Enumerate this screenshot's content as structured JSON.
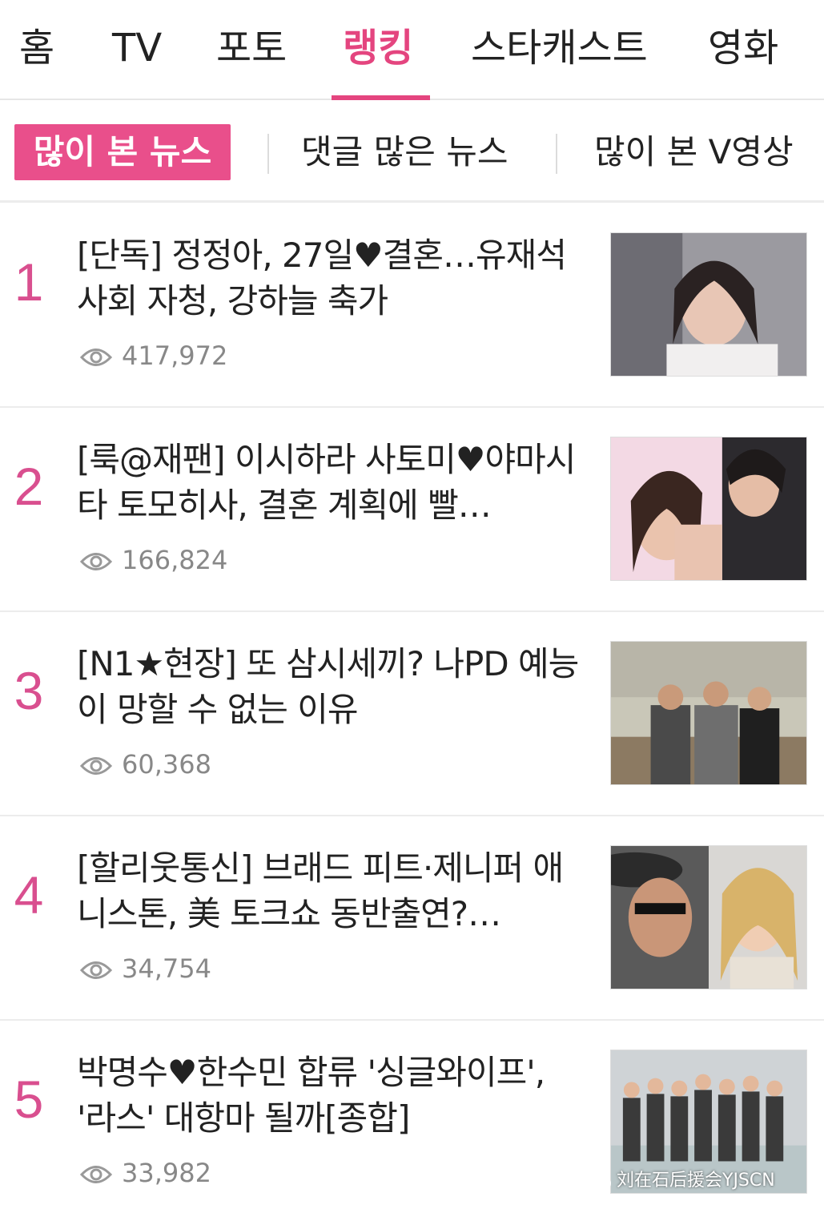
{
  "top_nav": {
    "tabs": [
      {
        "label": "홈"
      },
      {
        "label": "TV"
      },
      {
        "label": "포토"
      },
      {
        "label": "랭킹",
        "active": true
      },
      {
        "label": "스타캐스트"
      },
      {
        "label": "영화"
      }
    ],
    "accent_color": "#e4457f"
  },
  "sub_nav": {
    "tabs": [
      {
        "label": "많이 본 뉴스",
        "active": true
      },
      {
        "label": "댓글 많은 뉴스"
      },
      {
        "label": "많이 본 V영상"
      }
    ]
  },
  "news": [
    {
      "rank": "1",
      "headline": "[단독] 정정아, 27일♥결혼…유재석 사회 자청, 강하늘 축가",
      "views": "417,972"
    },
    {
      "rank": "2",
      "headline": "[룩@재팬] 이시하라 사토미♥야마시타 토모히사, 결혼 계획에 빨…",
      "views": "166,824"
    },
    {
      "rank": "3",
      "headline": "[N1★현장] 또 삼시세끼? 나PD 예능이 망할 수 없는 이유",
      "views": "60,368"
    },
    {
      "rank": "4",
      "headline": "[할리웃통신] 브래드 피트·제니퍼 애니스톤, 美 토크쇼 동반출연?…",
      "views": "34,754"
    },
    {
      "rank": "5",
      "headline": "박명수♥한수민 합류 '싱글와이프', '라스' 대항마 될까[종합]",
      "views": "33,982"
    }
  ],
  "watermark": {
    "text": "刘在石后援会YJSCN",
    "icon": "wechat-icon"
  },
  "icons": {
    "views": "eye-icon"
  }
}
